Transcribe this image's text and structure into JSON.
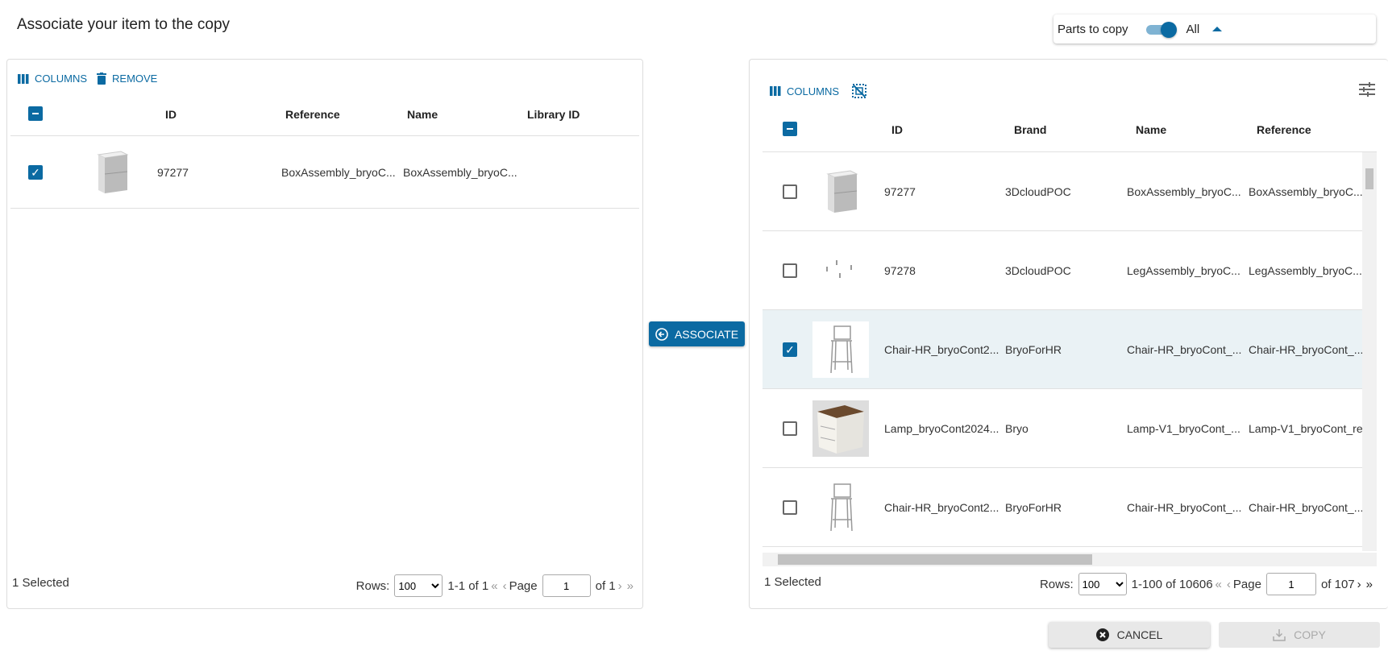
{
  "title": "Associate your item to the copy",
  "parts_to_copy": {
    "label": "Parts to copy",
    "toggle_on": true,
    "value": "All"
  },
  "colors": {
    "accent": "#0b6aa2",
    "selected_row": "#eaf2f5"
  },
  "left": {
    "toolbar": {
      "columns": "COLUMNS",
      "remove": "REMOVE"
    },
    "headers": [
      "ID",
      "Reference",
      "Name",
      "Library ID"
    ],
    "rows": [
      {
        "checked": true,
        "thumb": "cabinet",
        "id": "97277",
        "reference": "BoxAssembly_bryoC...",
        "name": "BoxAssembly_bryoC...",
        "library_id": ""
      }
    ],
    "footer": {
      "selected": "1 Selected",
      "rows_label": "Rows:",
      "rows_value": "100",
      "range": "1-1 of 1",
      "page_label": "Page",
      "page": "1",
      "of": "of 1"
    }
  },
  "associate": "ASSOCIATE",
  "right": {
    "toolbar": {
      "columns": "COLUMNS"
    },
    "headers": [
      "ID",
      "Brand",
      "Name",
      "Reference"
    ],
    "rows": [
      {
        "checked": false,
        "thumb": "cabinet",
        "id": "97277",
        "brand": "3DcloudPOC",
        "name": "BoxAssembly_bryoC...",
        "reference": "BoxAssembly_bryoC..."
      },
      {
        "checked": false,
        "thumb": "legs",
        "id": "97278",
        "brand": "3DcloudPOC",
        "name": "LegAssembly_bryoC...",
        "reference": "LegAssembly_bryoC..."
      },
      {
        "checked": true,
        "thumb": "chair",
        "id": "Chair-HR_bryoCont2...",
        "brand": "BryoForHR",
        "name": "Chair-HR_bryoCont_...",
        "reference": "Chair-HR_bryoCont_..."
      },
      {
        "checked": false,
        "thumb": "wood-cabinet",
        "id": "Lamp_bryoCont2024...",
        "brand": "Bryo",
        "name": "Lamp-V1_bryoCont_...",
        "reference": "Lamp-V1_bryoCont_re"
      },
      {
        "checked": false,
        "thumb": "chair",
        "id": "Chair-HR_bryoCont2...",
        "brand": "BryoForHR",
        "name": "Chair-HR_bryoCont_...",
        "reference": "Chair-HR_bryoCont_..."
      }
    ],
    "footer": {
      "selected": "1 Selected",
      "rows_label": "Rows:",
      "rows_value": "100",
      "range": "1-100 of 10606",
      "page_label": "Page",
      "page": "1",
      "of": "of 107"
    }
  },
  "buttons": {
    "cancel": "CANCEL",
    "copy": "COPY"
  }
}
